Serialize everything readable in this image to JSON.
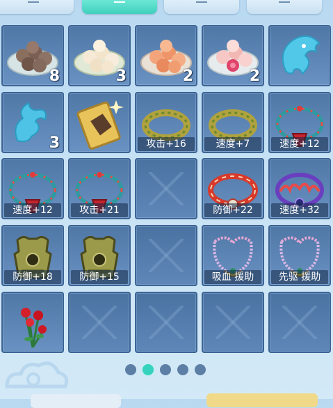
{
  "tabs": [
    {
      "icon": "tab-1-icon",
      "active": false
    },
    {
      "icon": "tab-2-icon",
      "active": true
    },
    {
      "icon": "tab-3-icon",
      "active": false
    },
    {
      "icon": "tab-4-icon",
      "active": false
    }
  ],
  "inventory": {
    "slots": [
      {
        "icon": "brown-dumplings-icon",
        "count": "8",
        "label": ""
      },
      {
        "icon": "white-dumplings-icon",
        "count": "3",
        "label": ""
      },
      {
        "icon": "orange-dumplings-icon",
        "count": "2",
        "label": ""
      },
      {
        "icon": "pink-dumplings-icon",
        "count": "2",
        "label": ""
      },
      {
        "icon": "water-spirit-head-icon",
        "count": "",
        "label": ""
      },
      {
        "icon": "water-spirit-tail-icon",
        "count": "3",
        "label": ""
      },
      {
        "icon": "golden-card-icon",
        "count": "",
        "label": ""
      },
      {
        "icon": "gold-ring-icon",
        "count": "",
        "label": "攻击+16"
      },
      {
        "icon": "gold-ring-icon",
        "count": "",
        "label": "速度+7"
      },
      {
        "icon": "jeweled-necklace-icon",
        "count": "",
        "label": "速度+12"
      },
      {
        "icon": "jeweled-necklace-icon",
        "count": "",
        "label": "速度+12"
      },
      {
        "icon": "jeweled-necklace-icon",
        "count": "",
        "label": "攻击+21"
      },
      {
        "icon": "",
        "count": "",
        "label": ""
      },
      {
        "icon": "red-bracelet-icon",
        "count": "",
        "label": "防御+22"
      },
      {
        "icon": "flame-necklace-icon",
        "count": "",
        "label": "速度+32"
      },
      {
        "icon": "armor-icon",
        "count": "",
        "label": "防御+18"
      },
      {
        "icon": "armor-icon",
        "count": "",
        "label": "防御+15"
      },
      {
        "icon": "",
        "count": "",
        "label": ""
      },
      {
        "icon": "bead-pendant-icon",
        "count": "",
        "label": "吸血 援助"
      },
      {
        "icon": "bead-pendant-icon",
        "count": "",
        "label": "先驱 援助"
      },
      {
        "icon": "red-roses-icon",
        "count": "",
        "label": ""
      },
      {
        "icon": "",
        "count": "",
        "label": ""
      },
      {
        "icon": "",
        "count": "",
        "label": ""
      },
      {
        "icon": "",
        "count": "",
        "label": ""
      },
      {
        "icon": "",
        "count": "",
        "label": ""
      }
    ]
  },
  "pagination": {
    "total": 5,
    "current": 2
  }
}
